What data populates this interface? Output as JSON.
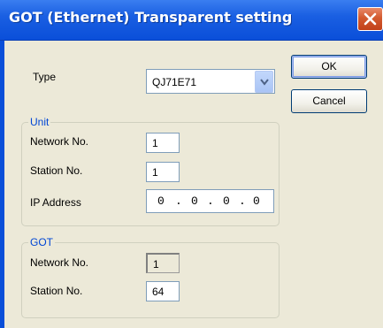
{
  "window": {
    "title": "GOT (Ethernet) Transparent setting"
  },
  "buttons": {
    "ok_label": "OK",
    "cancel_label": "Cancel"
  },
  "type": {
    "label": "Type",
    "value": "QJ71E71"
  },
  "unit": {
    "group_label": "Unit",
    "network_label": "Network No.",
    "network_value": "1",
    "station_label": "Station No.",
    "station_value": "1",
    "ip_label": "IP Address",
    "ip_octets": [
      "0",
      "0",
      "0",
      "0"
    ],
    "ip_sep": "."
  },
  "got": {
    "group_label": "GOT",
    "network_label": "Network No.",
    "network_value": "1",
    "station_label": "Station No.",
    "station_value": "64"
  }
}
